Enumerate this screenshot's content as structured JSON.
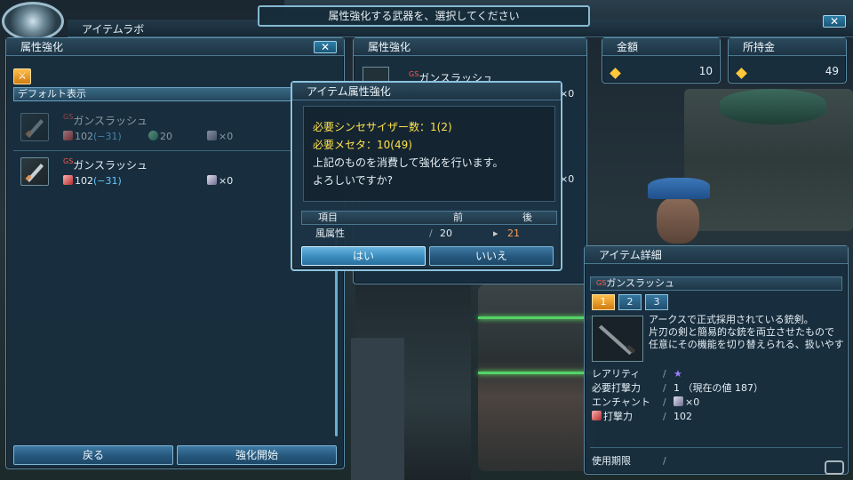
{
  "header": {
    "app_title": "アイテムラボ",
    "banner": "属性強化する武器を、選択してください"
  },
  "left_panel": {
    "title": "属性強化",
    "filter_label": "デフォルト表示",
    "items": [
      {
        "name": "ガンスラッシュ",
        "prefix": "GS",
        "attack": "102",
        "attack_mod": "(−31)",
        "grind_count": "20",
        "cube": "×0",
        "dimmed": true
      },
      {
        "name": "ガンスラッシュ",
        "prefix": "GS",
        "attack": "102",
        "attack_mod": "(−31)",
        "grind_count": "",
        "cube": "×0",
        "dimmed": false
      }
    ],
    "back_button": "戻る",
    "start_button": "強化開始"
  },
  "middle_panel": {
    "title": "属性強化",
    "item_name": "ガンスラッシュ",
    "item_prefix": "GS",
    "counts": [
      "×0",
      "×0"
    ]
  },
  "money": {
    "cost_label": "金額",
    "cost_value": "10",
    "held_label": "所持金",
    "held_value": "49"
  },
  "dialog": {
    "title": "アイテム属性強化",
    "line1": "必要シンセサイザー数：1(2)",
    "line2": "必要メセタ：10(49)",
    "line3": "上記のものを消費して強化を行います。",
    "line4": "よろしいですか?",
    "table_headers": [
      "項目",
      "前",
      "後"
    ],
    "row_label": "風属性",
    "before": "20",
    "after": "21",
    "yes": "はい",
    "no": "いいえ"
  },
  "detail_panel": {
    "title": "アイテム詳細",
    "item_name": "ガンスラッシュ",
    "item_prefix": "GS",
    "tabs": [
      "1",
      "2",
      "3"
    ],
    "description": [
      "アークスで正式採用されている銃剣。",
      "片刃の剣と簡易的な銃を両立させたもので",
      "任意にその機能を切り替えられる、扱いやす"
    ],
    "rows": [
      {
        "label": "レアリティ",
        "value": "★"
      },
      {
        "label": "必要打撃力",
        "value": "1 （現在の値 187）"
      },
      {
        "label": "エンチャント",
        "value": "×0"
      },
      {
        "label": "打撃力",
        "value": "102"
      }
    ],
    "expiry_label": "使用期限"
  },
  "colors": {
    "accent_blue": "#3a8bbd",
    "highlight_yellow": "#ffe14a",
    "after_value_orange": "#ff9e5a",
    "negative_cyan": "#66c8ff",
    "active_tab_orange": "#d07c10"
  },
  "icons": [
    "close-icon",
    "sword-icon",
    "gunslash-icon",
    "attack-icon",
    "grinder-icon",
    "cube-icon",
    "meseta-icon",
    "star-icon",
    "arrow-icon",
    "watermark-icon"
  ]
}
